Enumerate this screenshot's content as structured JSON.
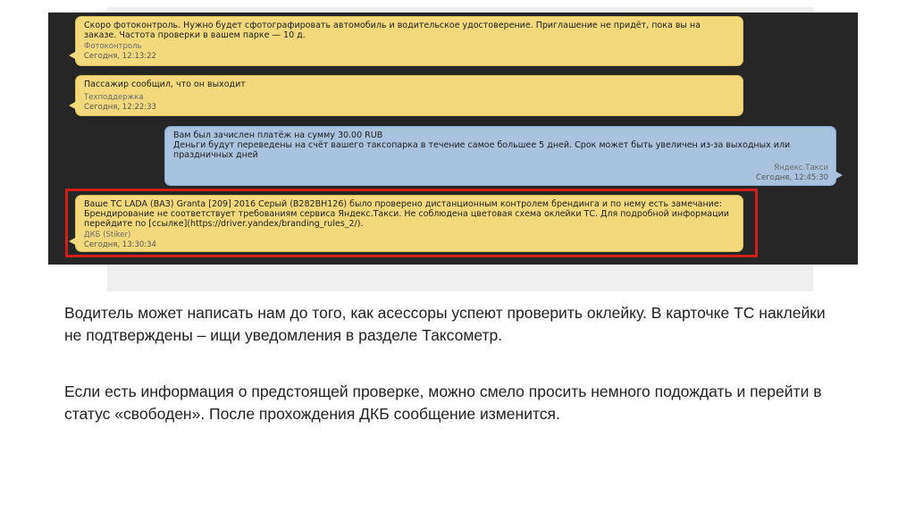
{
  "messages": [
    {
      "text": "Скоро фотоконтроль. Нужно будет сфотографировать автомобиль и водительское удостоверение. Приглашение не придёт, пока вы на заказе. Частота проверки в вашем парке — 10 д.",
      "sender": "Фотоконтроль",
      "time": "Сегодня, 12:13:22",
      "color": "#f3d97b"
    },
    {
      "text": "Пассажир сообщил, что он выходит",
      "sender": "Техподдержка",
      "time": "Сегодня, 12:22:33",
      "color": "#f3d97b"
    },
    {
      "text_line1": "Вам был зачислен платёж на сумму 30.00 RUB",
      "text_line2": "Деньги будут переведены на счёт вашего таксопарка в течение самое большее 5 дней. Срок может быть увеличен из-за выходных или праздничных дней",
      "sender": "Яндекс.Такси",
      "time": "Сегодня, 12:45:30",
      "color": "#a9c2e0"
    },
    {
      "text": "Ваше ТС LADA (ВАЗ) Granta [209] 2016 Серый (В282ВН126) было проверено дистанционным контролем брендинга и по нему есть замечание: Брендирование не соответствует требованиям сервиса Яндекс.Такси. Не соблюдена цветовая схема оклейки ТС. Для подробной информации перейдите по [ссылке](https://driver.yandex/branding_rules_2/).",
      "sender": "ДКБ (Stiker)",
      "time": "Сегодня, 13:30:34",
      "color": "#f3d97b",
      "highlight_color": "#d1201b"
    }
  ],
  "caption": {
    "paragraph1": "Водитель может написать нам до того, как асессоры успеют проверить оклейку. В карточке ТС наклейки не подтверждены – ищи уведомления в разделе Таксометр.",
    "paragraph2": "Если есть информация о предстоящей проверке, можно смело просить немного подождать и перейти в статус «свободен». После прохождения ДКБ сообщение изменится."
  }
}
